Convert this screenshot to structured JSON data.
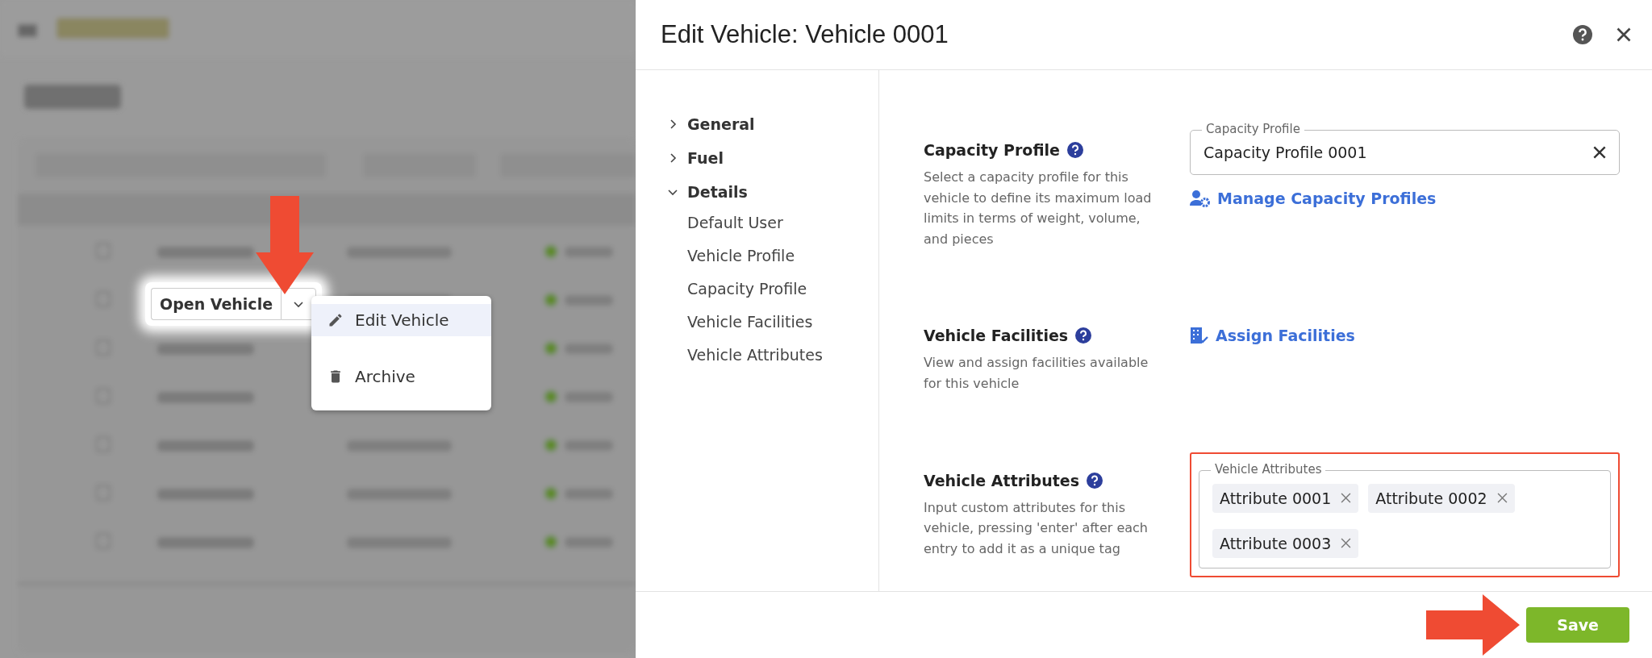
{
  "background": {
    "split_button": {
      "label": "Open Vehicle"
    },
    "menu": [
      {
        "label": "Edit Vehicle",
        "kind": "edit",
        "selected": true
      },
      {
        "label": "Archive",
        "kind": "archive",
        "selected": false
      }
    ]
  },
  "dialog": {
    "title": "Edit Vehicle: Vehicle 0001",
    "nav": [
      {
        "label": "General",
        "expanded": false
      },
      {
        "label": "Fuel",
        "expanded": false
      },
      {
        "label": "Details",
        "expanded": true,
        "children": [
          {
            "label": "Default User"
          },
          {
            "label": "Vehicle Profile"
          },
          {
            "label": "Capacity Profile"
          },
          {
            "label": "Vehicle Facilities"
          },
          {
            "label": "Vehicle Attributes"
          }
        ]
      }
    ],
    "sections": [
      {
        "heading": "Capacity Profile",
        "description": "Select a capacity profile for this vehicle to define its maximum load limits in terms of weight, volume, and pieces",
        "kind": "select",
        "field_label": "Capacity Profile",
        "value": "Capacity Profile 0001",
        "link": "Manage Capacity Profiles"
      },
      {
        "heading": "Vehicle Facilities",
        "description": "View and assign facilities available for this vehicle",
        "kind": "link",
        "link": "Assign Facilities"
      },
      {
        "heading": "Vehicle Attributes",
        "description": "Input custom attributes for this vehicle, pressing 'enter' after each entry to add it as a unique tag",
        "kind": "tags",
        "field_label": "Vehicle Attributes",
        "highlighted": true,
        "tags": [
          "Attribute 0001",
          "Attribute 0002",
          "Attribute 0003"
        ]
      }
    ],
    "save_button": "Save"
  }
}
